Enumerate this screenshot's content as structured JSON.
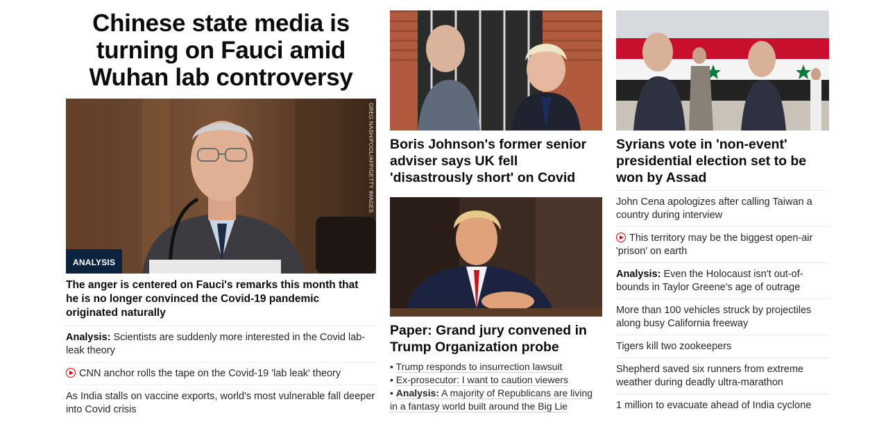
{
  "column1": {
    "headline": "Chinese state media is turning on Fauci amid Wuhan lab controversy",
    "image_label": "ANALYSIS",
    "image_credit": "GREG NASH/POOL/AFP/GETTY IMAGES",
    "summary": "The anger is centered on Fauci's remarks this month that he is no longer convinced the Covid-19 pandemic originated naturally",
    "stories": [
      {
        "prefix": "Analysis:",
        "text": "Scientists are suddenly more interested in the Covid lab-leak theory"
      },
      {
        "video": true,
        "text": "CNN anchor rolls the tape on the Covid-19 'lab leak' theory"
      },
      {
        "text": "As India stalls on vaccine exports, world's most vulnerable fall deeper into Covid crisis"
      }
    ]
  },
  "column2": {
    "story1": {
      "headline": "Boris Johnson's former senior adviser says UK fell 'disastrously short' on Covid"
    },
    "story2": {
      "headline": "Paper: Grand jury convened in Trump Organization probe",
      "bullets": [
        {
          "text": "Trump responds to insurrection lawsuit"
        },
        {
          "text": "Ex-prosecutor: I want to caution viewers"
        },
        {
          "prefix": "Analysis:",
          "text": "A majority of Republicans are living in a fantasy world built around the Big Lie"
        }
      ]
    }
  },
  "column3": {
    "headline": "Syrians vote in 'non-event' presidential election set to be won by Assad",
    "stories": [
      {
        "text": "John Cena apologizes after calling Taiwan a country during interview"
      },
      {
        "video": true,
        "text": "This territory may be the biggest open-air 'prison' on earth"
      },
      {
        "prefix": "Analysis:",
        "text": "Even the Holocaust isn't out-of-bounds in Taylor Greene's age of outrage"
      },
      {
        "text": "More than 100 vehicles struck by projectiles along busy California freeway"
      },
      {
        "text": "Tigers kill two zookeepers"
      },
      {
        "text": "Shepherd saved six runners from extreme weather during deadly ultra-marathon"
      },
      {
        "text": "1 million to evacuate ahead of India cyclone"
      }
    ]
  },
  "colors": {
    "analysis_badge": "#0c2340",
    "video_icon": "#cc0000",
    "divider": "#e6e6e6"
  }
}
